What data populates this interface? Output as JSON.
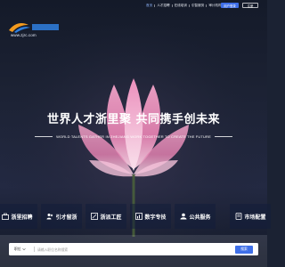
{
  "header": {
    "logo_url": "www.zjrc.com",
    "nav": [
      "首页",
      "人才招聘",
      "在线培训",
      "引智服务",
      "审计机构"
    ],
    "register_label": "用户登录",
    "login_label": "注册"
  },
  "hero": {
    "title": "世界人才浙里聚  共同携手创未来",
    "subtitle": "WORLD TALENTS GATHER IN ZHEJIANG   WORK TOGETHER TO CREATE THE FUTURE"
  },
  "tiles": [
    {
      "label": "浙里招聘",
      "icon": "briefcase-icon"
    },
    {
      "label": "引才留浙",
      "icon": "people-icon"
    },
    {
      "label": "浙派工匠",
      "icon": "tools-icon"
    },
    {
      "label": "数字专技",
      "icon": "chart-icon"
    },
    {
      "label": "公共服务",
      "icon": "service-icon"
    },
    {
      "label": "市场配置",
      "icon": "market-icon"
    }
  ],
  "search": {
    "category": "职位",
    "placeholder": "请输入职位名称搜索",
    "button_label": "搜索"
  },
  "colors": {
    "accent": "#3f6fe8",
    "logo_orange": "#f39a1e",
    "logo_blue": "#2f7fe0"
  }
}
